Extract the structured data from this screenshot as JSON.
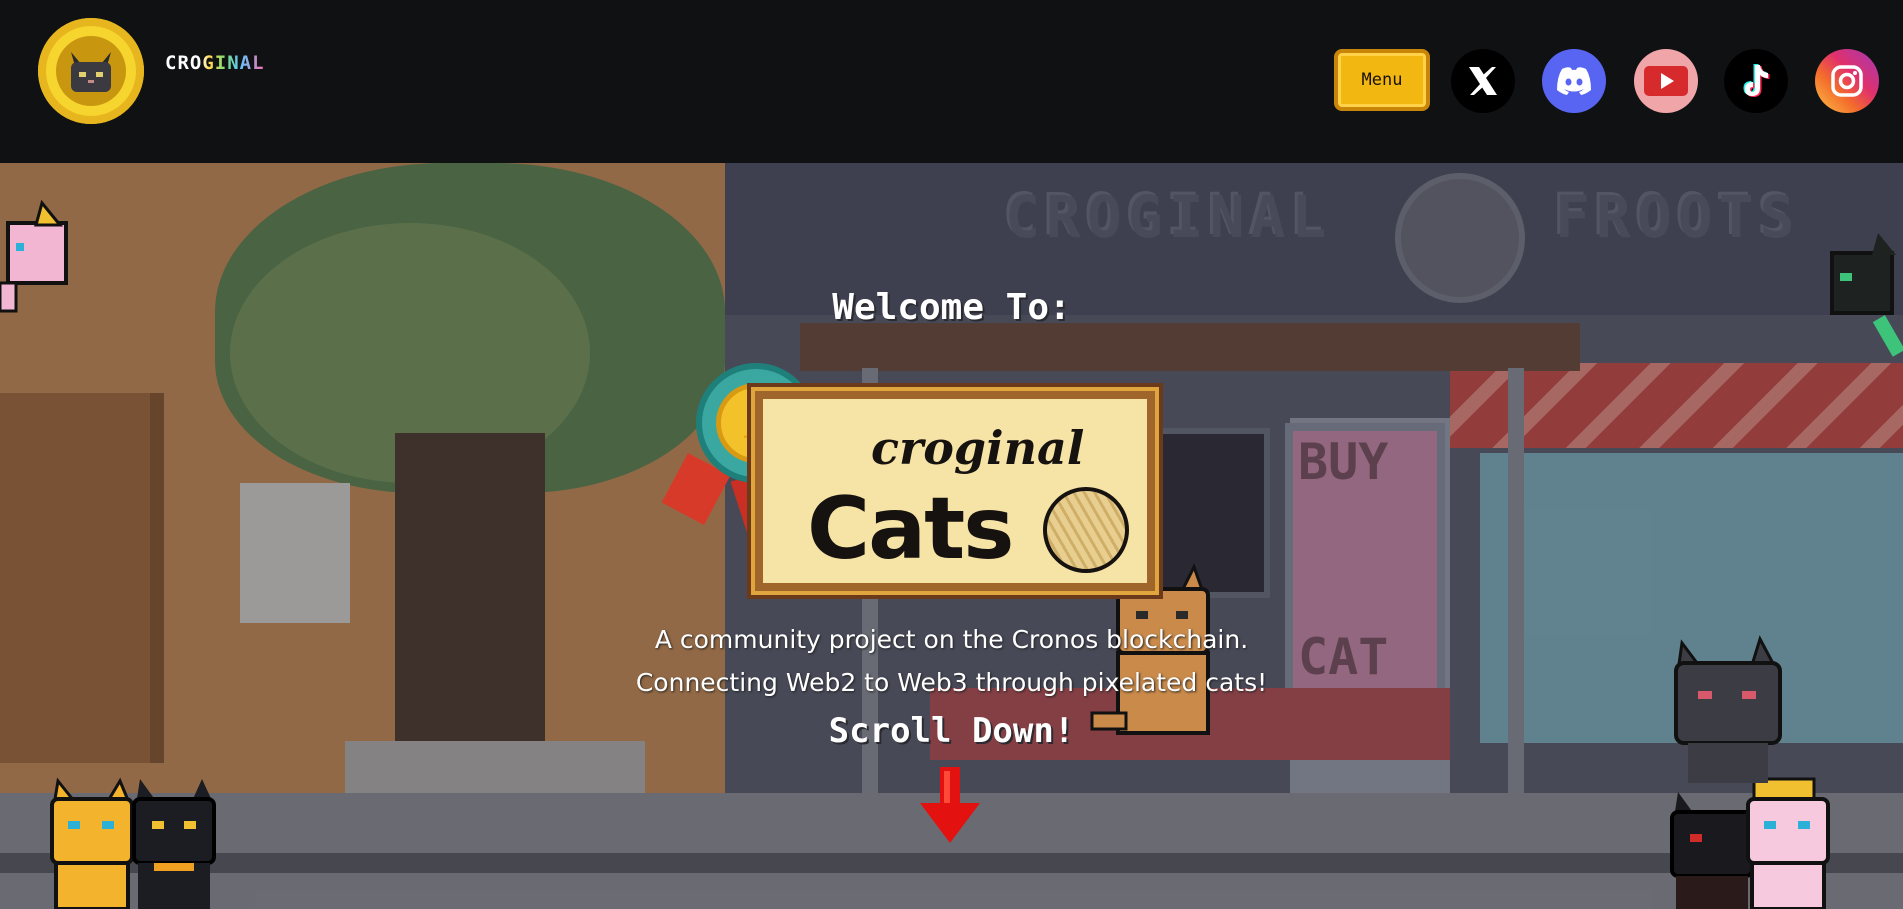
{
  "header": {
    "brand_text": "CROGINAL",
    "menu_label": "Menu",
    "social_links": [
      {
        "name": "x",
        "icon": "x-icon"
      },
      {
        "name": "discord",
        "icon": "discord-icon"
      },
      {
        "name": "youtube",
        "icon": "youtube-icon"
      },
      {
        "name": "tiktok",
        "icon": "tiktok-icon"
      },
      {
        "name": "instagram",
        "icon": "instagram-icon"
      }
    ]
  },
  "hero": {
    "welcome": "Welcome To:",
    "logo_word": "croginal",
    "logo_cats": "Cats",
    "tagline_1": "A community project on the Cronos blockchain.",
    "tagline_2": "Connecting Web2 to Web3 through pixelated cats!",
    "scroll_label": "Scroll Down!",
    "background_sign_left": "CROGINAL",
    "background_sign_right": "FROOTS",
    "poster_top": "BUY",
    "poster_bottom": "CAT"
  },
  "colors": {
    "header_bg": "#101113",
    "menu_button": "#f2b711",
    "discord": "#5865f2",
    "arrow": "#e3110f"
  }
}
